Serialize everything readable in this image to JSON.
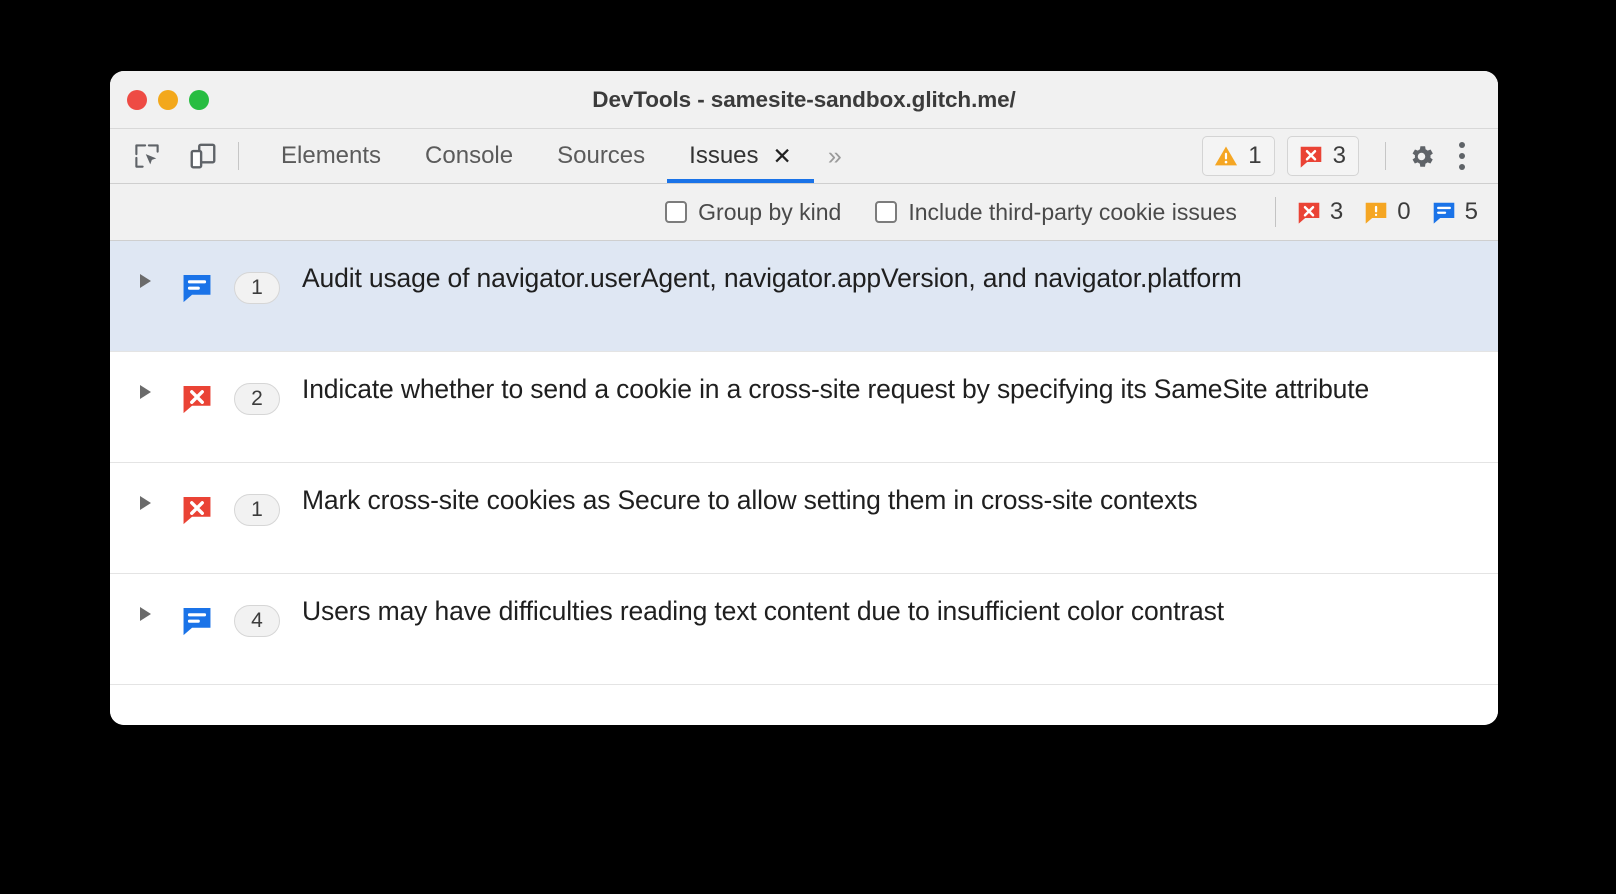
{
  "window": {
    "title": "DevTools - samesite-sandbox.glitch.me/",
    "traffic_lights": [
      {
        "name": "close",
        "color": "#ee4b44"
      },
      {
        "name": "minimize",
        "color": "#f3a81b"
      },
      {
        "name": "maximize",
        "color": "#27bd41"
      }
    ]
  },
  "toolbar": {
    "inspect_icon": "inspect-element-icon",
    "device_icon": "device-toolbar-icon",
    "tabs": [
      {
        "label": "Elements",
        "active": false
      },
      {
        "label": "Console",
        "active": false
      },
      {
        "label": "Sources",
        "active": false
      },
      {
        "label": "Issues",
        "active": true
      }
    ],
    "tab_close_label": "✕",
    "more_tabs_label": "»",
    "warning_count": "1",
    "error_count": "3",
    "settings_icon": "gear-icon",
    "more_options_icon": "kebab-menu-icon"
  },
  "filterbar": {
    "group_by_kind_label": "Group by kind",
    "group_by_kind_checked": false,
    "third_party_label": "Include third-party cookie issues",
    "third_party_checked": false,
    "counts": {
      "errors": "3",
      "warnings": "0",
      "info": "5"
    }
  },
  "issues": [
    {
      "severity": "info",
      "count": "1",
      "title": "Audit usage of navigator.userAgent, navigator.appVersion, and navigator.platform",
      "selected": true,
      "expanded": false
    },
    {
      "severity": "error",
      "count": "2",
      "title": "Indicate whether to send a cookie in a cross-site request by specifying its SameSite attribute",
      "selected": false,
      "expanded": false
    },
    {
      "severity": "error",
      "count": "1",
      "title": "Mark cross-site cookies as Secure to allow setting them in cross-site contexts",
      "selected": false,
      "expanded": false
    },
    {
      "severity": "info",
      "count": "4",
      "title": "Users may have difficulties reading text content due to insufficient color contrast",
      "selected": false,
      "expanded": false
    }
  ],
  "colors": {
    "error_red": "#ea4335",
    "warning_orange": "#f5a623",
    "info_blue": "#1a73e8",
    "accent_blue": "#1a73e8",
    "selected_row": "#dfe7f3",
    "chrome_gray": "#f1f1f1"
  }
}
